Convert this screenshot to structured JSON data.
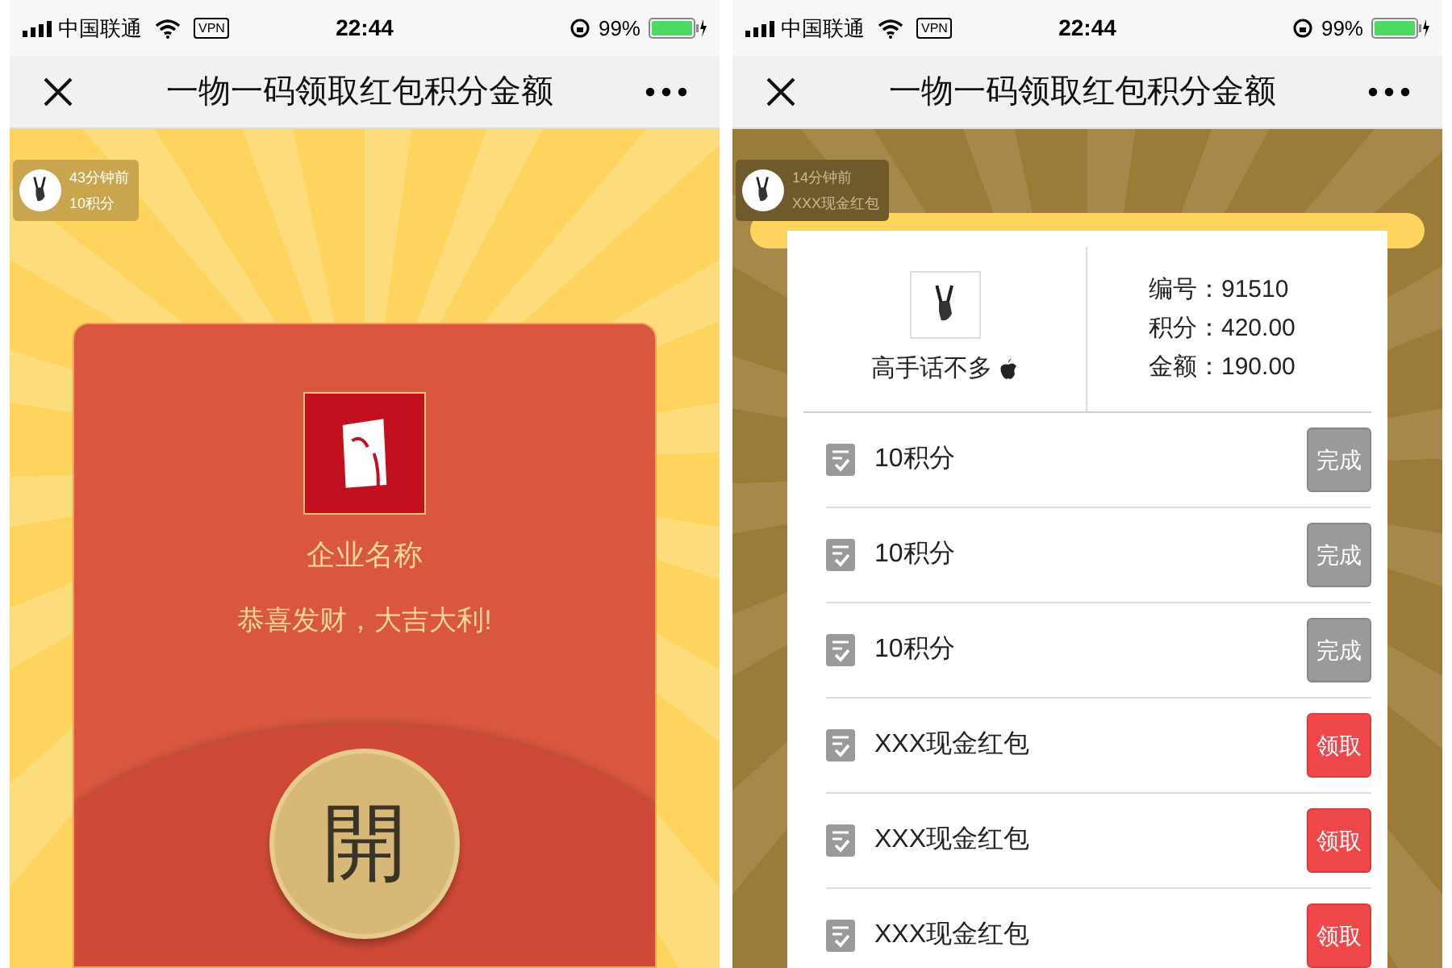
{
  "screens": [
    {
      "kind": "envelope",
      "status_bar": {
        "carrier": "中国联通",
        "vpn": "VPN",
        "time": "22:44",
        "battery": "99%"
      },
      "nav": {
        "title": "一物一码领取红包积分金额"
      },
      "notice": {
        "time": "43分钟前",
        "text": "10积分"
      },
      "envelope": {
        "company": "企业名称",
        "greeting": "恭喜发财，大吉大利!",
        "open_label": "開"
      }
    },
    {
      "kind": "list",
      "status_bar": {
        "carrier": "中国联通",
        "vpn": "VPN",
        "time": "22:44",
        "battery": "99%"
      },
      "nav": {
        "title": "一物一码领取红包积分金额"
      },
      "notice": {
        "time": "14分钟前",
        "text": "XXX现金红包"
      },
      "profile": {
        "name": "高手话不多",
        "fields": [
          {
            "label": "编号：",
            "value": "91510"
          },
          {
            "label": "积分：",
            "value": "420.00"
          },
          {
            "label": "金额：",
            "value": "190.00"
          }
        ]
      },
      "items": [
        {
          "text": "10积分",
          "kind": "done",
          "action": "完成"
        },
        {
          "text": "10积分",
          "kind": "done",
          "action": "完成"
        },
        {
          "text": "10积分",
          "kind": "done",
          "action": "完成"
        },
        {
          "text": "XXX现金红包",
          "kind": "claim",
          "action": "领取"
        },
        {
          "text": "XXX现金红包",
          "kind": "claim",
          "action": "领取"
        },
        {
          "text": "XXX现金红包",
          "kind": "claim",
          "action": "领取"
        }
      ]
    }
  ]
}
